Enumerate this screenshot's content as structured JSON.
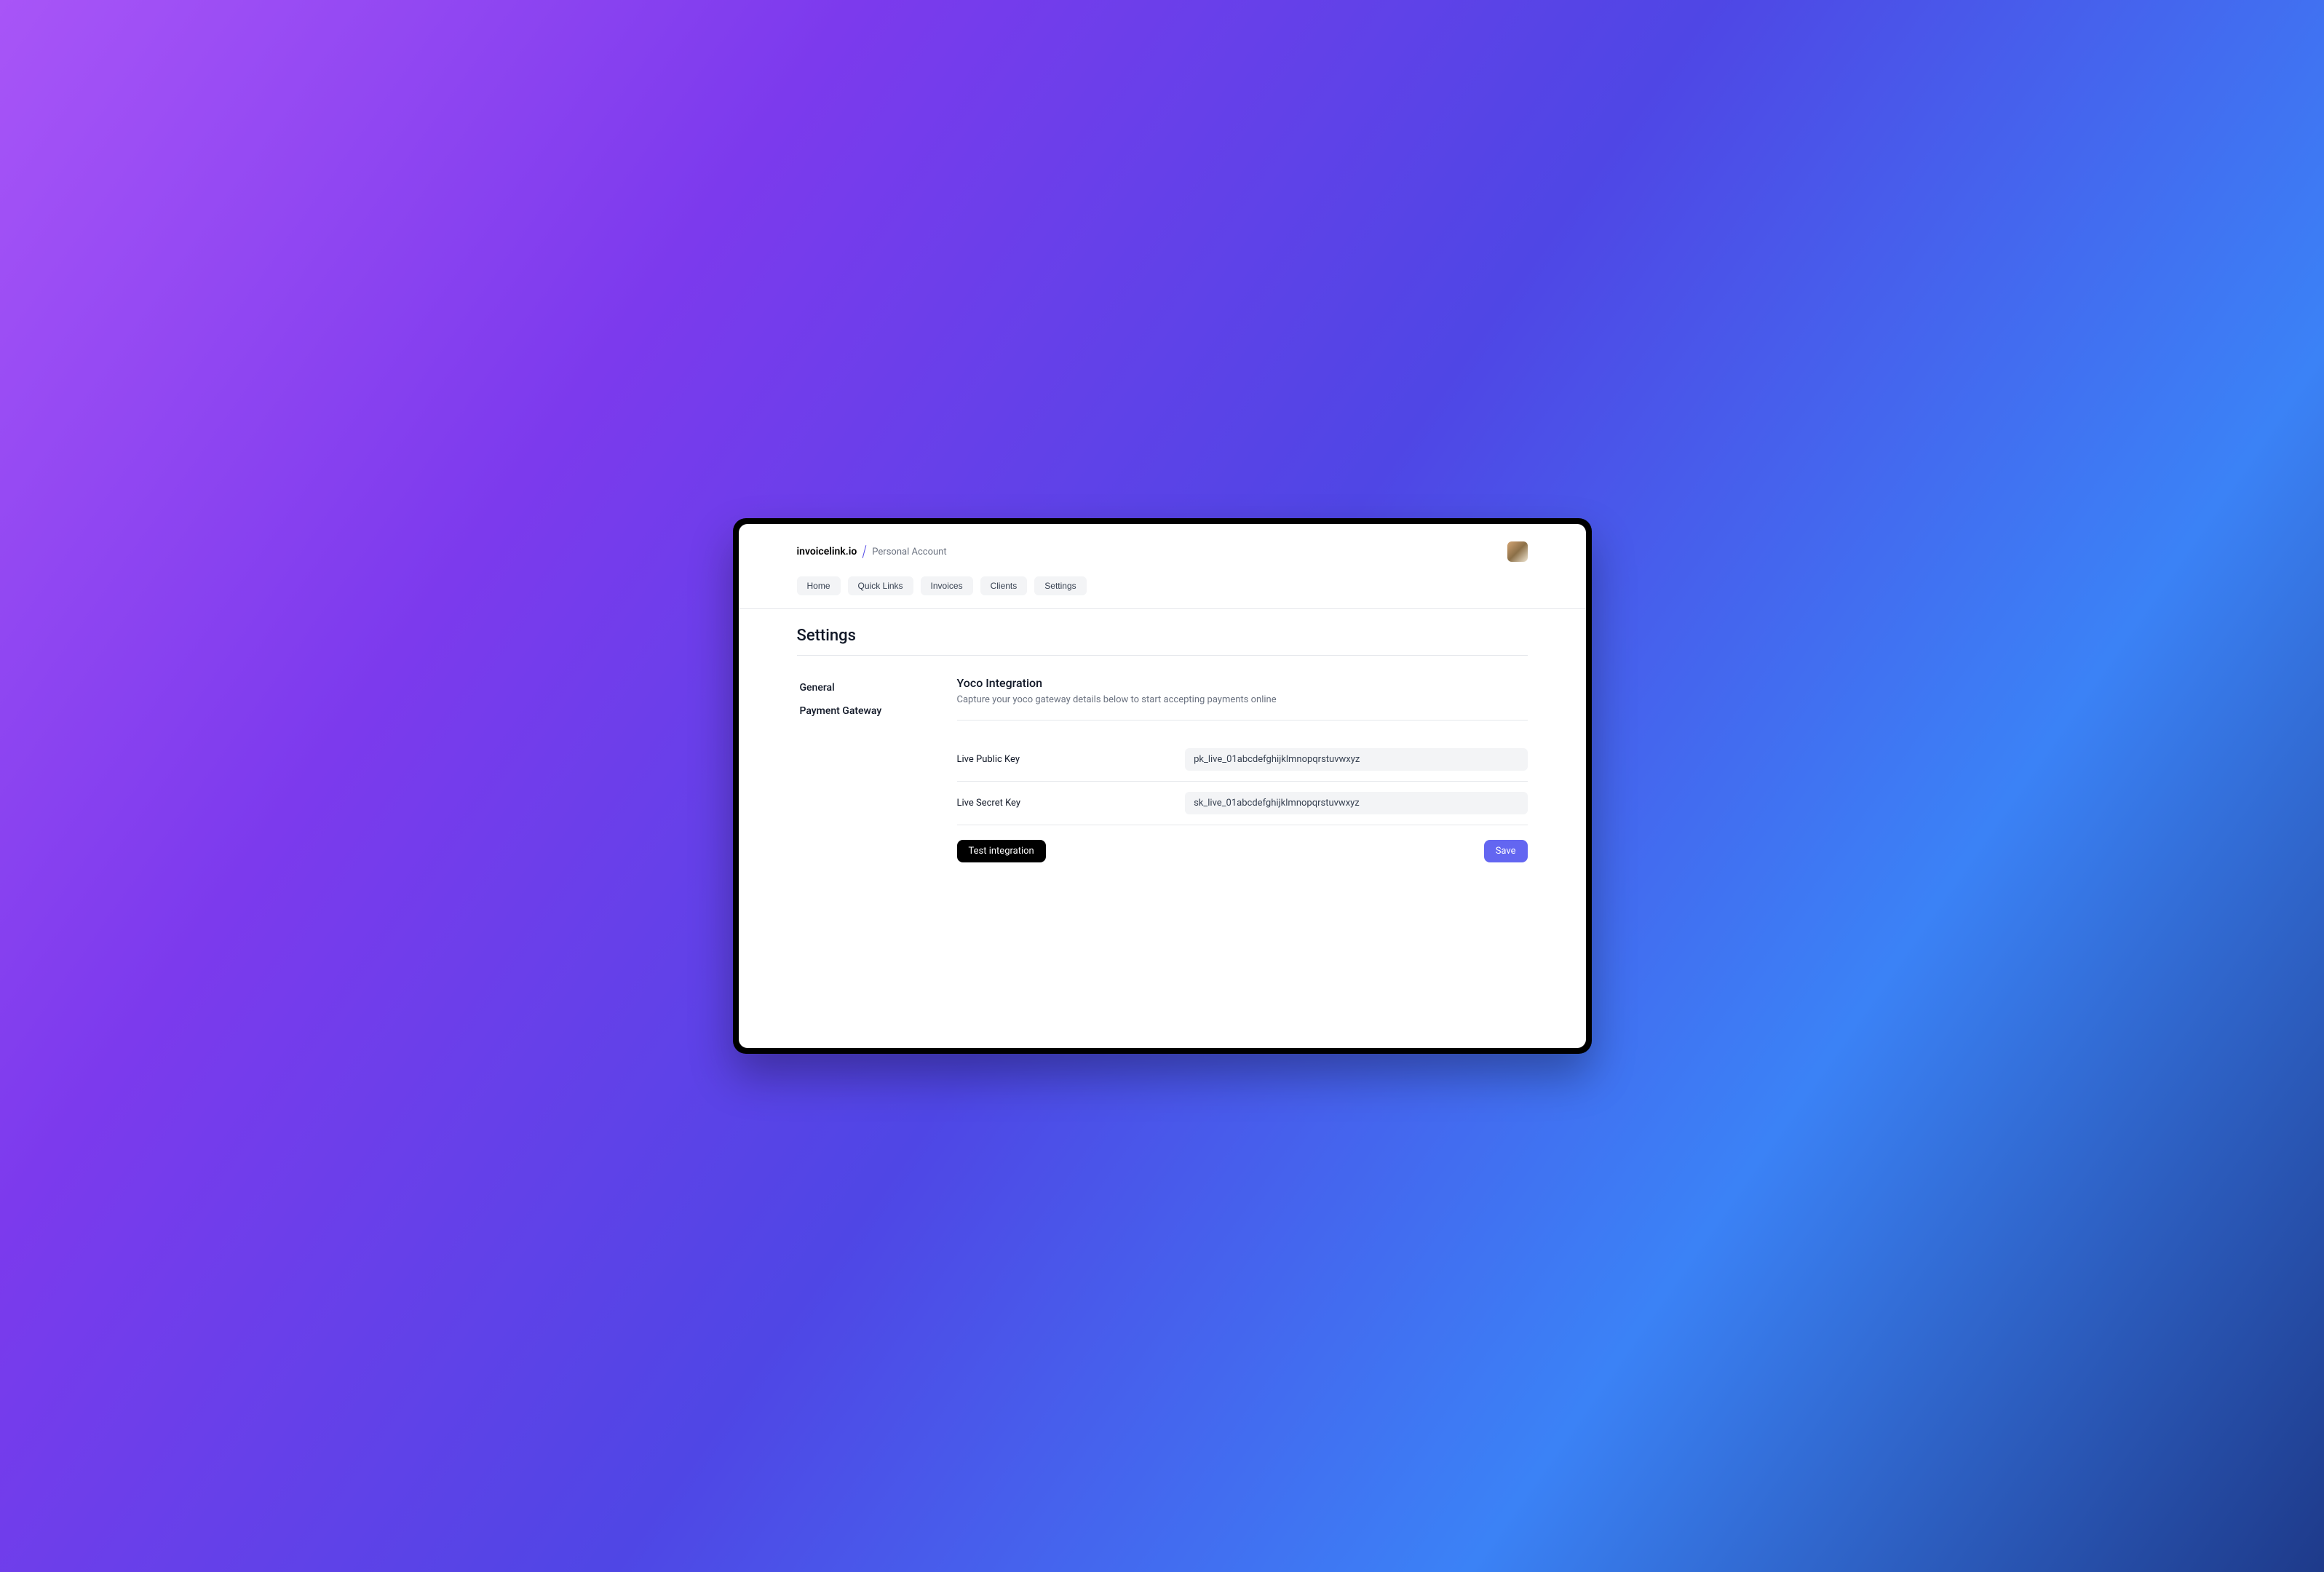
{
  "header": {
    "brand": "invoicelink.io",
    "account": "Personal Account"
  },
  "nav": {
    "items": [
      {
        "label": "Home"
      },
      {
        "label": "Quick Links"
      },
      {
        "label": "Invoices"
      },
      {
        "label": "Clients"
      },
      {
        "label": "Settings"
      }
    ]
  },
  "page": {
    "title": "Settings"
  },
  "sidebar": {
    "items": [
      {
        "label": "General"
      },
      {
        "label": "Payment Gateway"
      }
    ]
  },
  "section": {
    "title": "Yoco Integration",
    "description": "Capture your yoco gateway details below to start accepting payments online"
  },
  "fields": {
    "publicKey": {
      "label": "Live Public Key",
      "value": "pk_live_01abcdefghijklmnopqrstuvwxyz"
    },
    "secretKey": {
      "label": "Live Secret Key",
      "value": "sk_live_01abcdefghijklmnopqrstuvwxyz"
    }
  },
  "actions": {
    "test": "Test integration",
    "save": "Save"
  }
}
